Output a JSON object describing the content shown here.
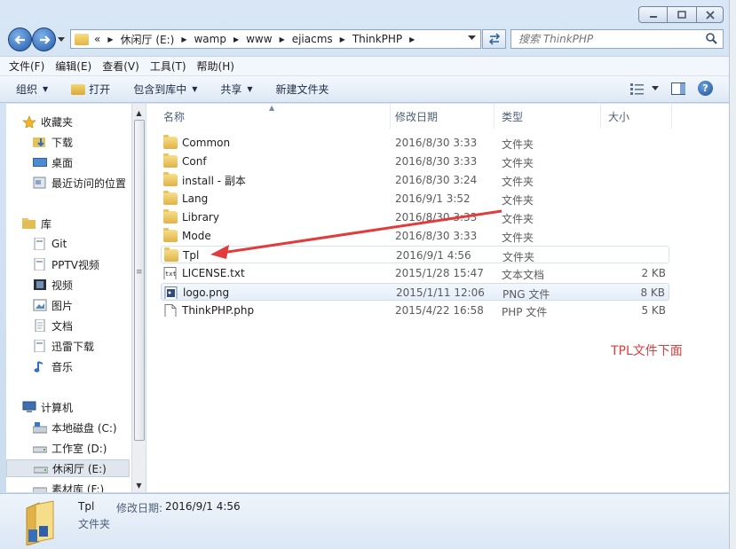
{
  "window": {
    "caption": {
      "minimize": "minimize",
      "maximize": "maximize",
      "close": "close"
    }
  },
  "address": {
    "overflow": "«",
    "crumbs": [
      "休闲厅 (E:)",
      "wamp",
      "www",
      "ejiacms",
      "ThinkPHP"
    ]
  },
  "search": {
    "placeholder": "搜索 ThinkPHP"
  },
  "menu": [
    "文件(F)",
    "编辑(E)",
    "查看(V)",
    "工具(T)",
    "帮助(H)"
  ],
  "commands": {
    "organize": "组织",
    "open": "打开",
    "include_library": "包含到库中",
    "share": "共享",
    "new_folder": "新建文件夹"
  },
  "sidebar": {
    "favorites": {
      "title": "收藏夹",
      "items": [
        "下载",
        "桌面",
        "最近访问的位置"
      ]
    },
    "libraries": {
      "title": "库",
      "items": [
        "Git",
        "PPTV视频",
        "视频",
        "图片",
        "文档",
        "迅雷下载",
        "音乐"
      ]
    },
    "computer": {
      "title": "计算机",
      "items": [
        "本地磁盘 (C:)",
        "工作室 (D:)",
        "休闲厅 (E:)",
        "素材库 (F:)"
      ]
    }
  },
  "columns": {
    "name": "名称",
    "date": "修改日期",
    "type": "类型",
    "size": "大小"
  },
  "files": [
    {
      "name": "Common",
      "date": "2016/8/30 3:33",
      "type": "文件夹",
      "size": "",
      "icon": "folder-icon"
    },
    {
      "name": "Conf",
      "date": "2016/8/30 3:33",
      "type": "文件夹",
      "size": "",
      "icon": "folder-icon"
    },
    {
      "name": "install - 副本",
      "date": "2016/8/30 3:24",
      "type": "文件夹",
      "size": "",
      "icon": "folder-icon"
    },
    {
      "name": "Lang",
      "date": "2016/9/1 3:52",
      "type": "文件夹",
      "size": "",
      "icon": "folder-icon"
    },
    {
      "name": "Library",
      "date": "2016/8/30 3:33",
      "type": "文件夹",
      "size": "",
      "icon": "folder-icon"
    },
    {
      "name": "Mode",
      "date": "2016/8/30 3:33",
      "type": "文件夹",
      "size": "",
      "icon": "folder-icon"
    },
    {
      "name": "Tpl",
      "date": "2016/9/1 4:56",
      "type": "文件夹",
      "size": "",
      "icon": "folder-icon"
    },
    {
      "name": "LICENSE.txt",
      "date": "2015/1/28 15:47",
      "type": "文本文档",
      "size": "2 KB",
      "icon": "text-file-icon"
    },
    {
      "name": "logo.png",
      "date": "2015/1/11 12:06",
      "type": "PNG 文件",
      "size": "8 KB",
      "icon": "png-file-icon"
    },
    {
      "name": "ThinkPHP.php",
      "date": "2015/4/22 16:58",
      "type": "PHP 文件",
      "size": "5 KB",
      "icon": "php-file-icon"
    }
  ],
  "annotation": {
    "text": "TPL文件下面",
    "color": "#e23b3b"
  },
  "details": {
    "name": "Tpl",
    "modified_label": "修改日期:",
    "modified_value": "2016/9/1 4:56",
    "type": "文件夹"
  }
}
